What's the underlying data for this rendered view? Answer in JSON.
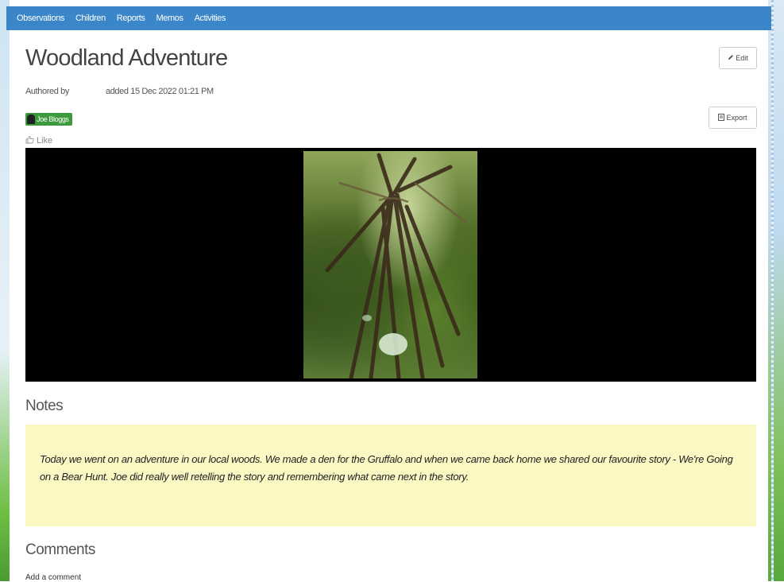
{
  "nav": {
    "items": [
      "Observations",
      "Children",
      "Reports",
      "Memos",
      "Activities"
    ]
  },
  "observation": {
    "title": "Woodland Adventure",
    "authored_label": "Authored by",
    "added_text": "added 15 Dec 2022 01:21 PM",
    "child_name": "Joe Bloggs",
    "like_label": "Like"
  },
  "actions": {
    "edit_label": "Edit",
    "export_label": "Export"
  },
  "notes": {
    "heading": "Notes",
    "text": "Today we went on an adventure in our local woods. We made a den for the Gruffalo and when we came back home we shared our favourite story - We're Going on a Bear Hunt. Joe did really well retelling the story and remembering what came next in the story."
  },
  "comments": {
    "heading": "Comments",
    "add_label": "Add a comment"
  },
  "colors": {
    "navbar": "#3a86c8",
    "child_tag": "#3c9a3c",
    "notes_bg": "#fcf8c4"
  }
}
